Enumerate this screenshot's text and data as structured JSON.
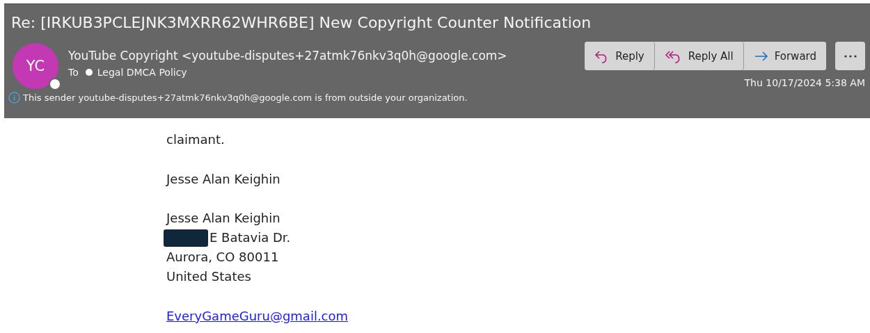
{
  "message": {
    "subject": "Re: [IRKUB3PCLEJNK3MXRR62WHR6BE] New Copyright Counter Notification",
    "sender": {
      "initials": "YC",
      "available": false,
      "display": "YouTube Copyright <youtube-disputes+27atmk76nkv3q0h@google.com>"
    },
    "to_label": "To",
    "recipient": {
      "name": "Legal DMCA Policy",
      "available": false
    },
    "actions": [
      {
        "kind": "reply",
        "label": "Reply"
      },
      {
        "kind": "reply_all",
        "label": "Reply All"
      },
      {
        "kind": "forward",
        "label": "Forward"
      }
    ],
    "date": "Thu 10/17/2024 5:38 AM",
    "notice": "This sender youtube-disputes+27atmk76nkv3q0h@google.com is from outside your organization."
  },
  "body": {
    "lines_1": [
      "claimant."
    ],
    "signature": "Jesse Alan Keighin",
    "address": [
      {
        "text": "Jesse Alan Keighin",
        "redacted": false
      },
      {
        "text": "E Batavia Dr.",
        "redacted": true
      },
      {
        "text": "Aurora, CO 80011",
        "redacted": false
      },
      {
        "text": "United States",
        "redacted": false
      }
    ],
    "email_link": "EveryGameGuru@gmail.com"
  }
}
